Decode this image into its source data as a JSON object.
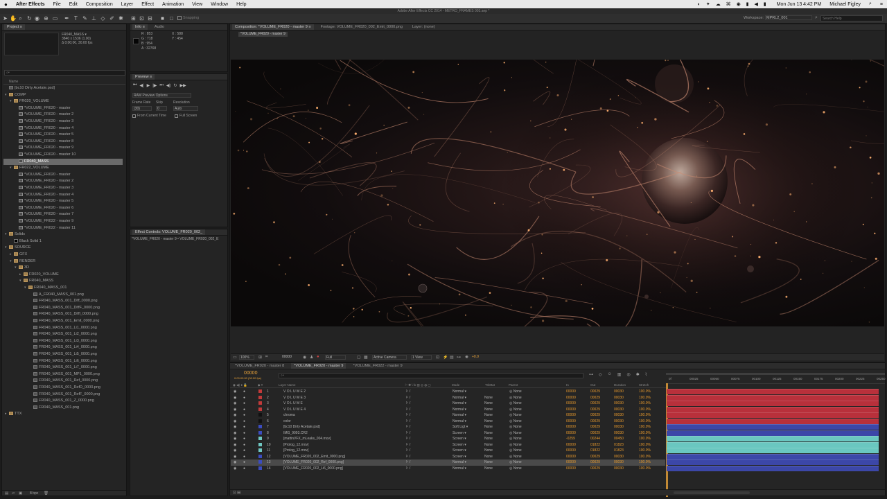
{
  "menubar": {
    "apple": "",
    "app": "After Effects",
    "items": [
      "File",
      "Edit",
      "Composition",
      "Layer",
      "Effect",
      "Animation",
      "View",
      "Window",
      "Help"
    ],
    "status_time": "Mon Jun 13 4:42 PM",
    "status_user": "Michael Figley"
  },
  "window_title": "Adobe After Effects CC 2014 - METRO_FRAMES 003.aep *",
  "toolbar": {
    "snapping_label": "Snapping",
    "workspace_label": "Workspace:",
    "workspace_value": "MPRL2_001",
    "search_placeholder": "Search Help"
  },
  "project": {
    "tab_label": "Project ≡",
    "selected_item": "FR040_MASS",
    "details": [
      "FR040_MASS ▾",
      "3840 x 1536 (1.00)",
      "Δ 0;00;00, 30.00 fps"
    ],
    "search_placeholder": "⌕▾",
    "col_name": "Name",
    "items": [
      {
        "indent": 0,
        "type": "file",
        "label": "[bc10 Dirty Acetate.psd]"
      },
      {
        "indent": 0,
        "type": "folder",
        "label": "COMP",
        "open": true
      },
      {
        "indent": 1,
        "type": "folder",
        "label": "FR020_VOLUME",
        "open": true
      },
      {
        "indent": 2,
        "type": "comp",
        "label": "*VOLUME_FR020 - master"
      },
      {
        "indent": 2,
        "type": "comp",
        "label": "*VOLUME_FR020 - master 2"
      },
      {
        "indent": 2,
        "type": "comp",
        "label": "*VOLUME_FR020 - master 3"
      },
      {
        "indent": 2,
        "type": "comp",
        "label": "*VOLUME_FR020 - master 4"
      },
      {
        "indent": 2,
        "type": "comp",
        "label": "*VOLUME_FR020 - master 5"
      },
      {
        "indent": 2,
        "type": "comp",
        "label": "*VOLUME_FR020 - master 8"
      },
      {
        "indent": 2,
        "type": "comp",
        "label": "*VOLUME_FR020 - master 9"
      },
      {
        "indent": 2,
        "type": "comp",
        "label": "*VOLUME_FR020 - master 10"
      },
      {
        "indent": 2,
        "type": "comp",
        "label": "FR040_MASS",
        "selected": true
      },
      {
        "indent": 1,
        "type": "folder",
        "label": "FR022_VOLUME",
        "open": true
      },
      {
        "indent": 2,
        "type": "comp",
        "label": "*VOLUME_FR020 - master"
      },
      {
        "indent": 2,
        "type": "comp",
        "label": "*VOLUME_FR020 - master 2"
      },
      {
        "indent": 2,
        "type": "comp",
        "label": "*VOLUME_FR020 - master 3"
      },
      {
        "indent": 2,
        "type": "comp",
        "label": "*VOLUME_FR020 - master 4"
      },
      {
        "indent": 2,
        "type": "comp",
        "label": "*VOLUME_FR020 - master 5"
      },
      {
        "indent": 2,
        "type": "comp",
        "label": "*VOLUME_FR020 - master 6"
      },
      {
        "indent": 2,
        "type": "comp",
        "label": "*VOLUME_FR020 - master 7"
      },
      {
        "indent": 2,
        "type": "comp",
        "label": "*VOLUME_FR022 - master 9"
      },
      {
        "indent": 2,
        "type": "comp",
        "label": "*VOLUME_FR022 - master 11"
      },
      {
        "indent": 0,
        "type": "folder",
        "label": "Solids",
        "open": true
      },
      {
        "indent": 1,
        "type": "solid",
        "label": "Black Solid 1"
      },
      {
        "indent": 0,
        "type": "folder",
        "label": "SOURCE",
        "open": true
      },
      {
        "indent": 1,
        "type": "folder",
        "label": "GFX"
      },
      {
        "indent": 1,
        "type": "folder",
        "label": "RENDER",
        "open": true
      },
      {
        "indent": 2,
        "type": "folder",
        "label": "3D",
        "open": true
      },
      {
        "indent": 3,
        "type": "folder",
        "label": "FR020_VOLUME"
      },
      {
        "indent": 3,
        "type": "folder",
        "label": "FR040_MASS",
        "open": true
      },
      {
        "indent": 4,
        "type": "folder",
        "label": "FR040_MASS_001",
        "open": true
      },
      {
        "indent": 5,
        "type": "file",
        "label": "A_FR040_MASS_001.png"
      },
      {
        "indent": 5,
        "type": "file",
        "label": "FR040_MASS_001_Diff_0000.png"
      },
      {
        "indent": 5,
        "type": "file",
        "label": "FR040_MASS_001_DiffF_0000.png"
      },
      {
        "indent": 5,
        "type": "file",
        "label": "FR040_MASS_001_Diffl_0000.png"
      },
      {
        "indent": 5,
        "type": "file",
        "label": "FR040_MASS_001_Emit_0000.png"
      },
      {
        "indent": 5,
        "type": "file",
        "label": "FR040_MASS_001_Li1_0000.png"
      },
      {
        "indent": 5,
        "type": "file",
        "label": "FR040_MASS_001_Li2_0000.png"
      },
      {
        "indent": 5,
        "type": "file",
        "label": "FR040_MASS_001_Li3_0000.png"
      },
      {
        "indent": 5,
        "type": "file",
        "label": "FR040_MASS_001_Li4_0000.png"
      },
      {
        "indent": 5,
        "type": "file",
        "label": "FR040_MASS_001_Li5_0000.png"
      },
      {
        "indent": 5,
        "type": "file",
        "label": "FR040_MASS_001_Li6_0000.png"
      },
      {
        "indent": 5,
        "type": "file",
        "label": "FR040_MASS_001_Li7_0000.png"
      },
      {
        "indent": 5,
        "type": "file",
        "label": "FR040_MASS_001_MP1_0000.png"
      },
      {
        "indent": 5,
        "type": "file",
        "label": "FR040_MASS_001_Ref_0000.png"
      },
      {
        "indent": 5,
        "type": "file",
        "label": "FR040_MASS_001_RefD_0000.png"
      },
      {
        "indent": 5,
        "type": "file",
        "label": "FR040_MASS_001_RefF_0000.png"
      },
      {
        "indent": 5,
        "type": "file",
        "label": "FR040_MASS_001_Z_0000.png"
      },
      {
        "indent": 5,
        "type": "file",
        "label": "FR040_MASS_001.png"
      },
      {
        "indent": 0,
        "type": "folder",
        "label": "TTX"
      }
    ],
    "footer_bpc": "8 bpc"
  },
  "info": {
    "tabs": [
      "Info ≡",
      "Audio"
    ],
    "r": "R : 853",
    "g": "G : 718",
    "b": "B : 954",
    "a": "A : 32768",
    "x": "X : 588",
    "y": "Y : 454"
  },
  "preview": {
    "tab": "Preview ≡",
    "ram_label": "RAM Preview Options",
    "frame_rate_label": "Frame Rate",
    "skip_label": "Skip",
    "resolution_label": "Resolution",
    "frame_rate_value": "(30)",
    "skip_value": "0",
    "resolution_value": "Auto",
    "from_current": "From Current Time",
    "full_screen": "Full Screen"
  },
  "effect_controls": {
    "tab": "Effect Controls: VOLUME_FR020_002_",
    "path": "*VOLUME_FR020 - master 9 • VOLUME_FR020_002_E"
  },
  "comp_viewer": {
    "tabs": [
      "Composition: *VOLUME_FR020 - master 9 ≡",
      "Footage: VOLUME_FR020_002_Emit_0000.png",
      "Layer: (none)"
    ],
    "flowchart_label": "*VOLUME_FR020 - master 9",
    "zoom": "100%",
    "timecode": "00000",
    "quality": "Full",
    "camera": "Active Camera",
    "view": "1 View",
    "exposure": "+0.0"
  },
  "timeline": {
    "tabs": [
      "*VOLUME_FR020 - master 8",
      "*VOLUME_FR020 - master 9",
      "*VOLUME_FR022 - master 9"
    ],
    "current_time": "00000",
    "current_time_sub": "0:00:00:00 (30.00 fps)",
    "columns": {
      "layer_name": "Layer Name",
      "mode": "Mode",
      "trkmat": "TrkMat",
      "parent": "Parent",
      "in": "In",
      "out": "Out",
      "duration": "Duration",
      "stretch": "Stretch"
    },
    "ruler": [
      "0f",
      "00025",
      "00050",
      "00075",
      "00100",
      "00125",
      "00150",
      "00175",
      "00200",
      "00225",
      "00250"
    ],
    "layers": [
      {
        "num": "1",
        "name": "V O L U M E  2",
        "label": "#c23a3a",
        "mode": "Normal",
        "trkmat": "",
        "parent": "None",
        "in": "00000",
        "out": "00029",
        "dur": "00030",
        "stretch": "100.0%",
        "bar": "red",
        "start": 0,
        "end": 1
      },
      {
        "num": "2",
        "name": "V O L U M E  3",
        "label": "#c23a3a",
        "mode": "Normal",
        "trkmat": "None",
        "parent": "None",
        "in": "00000",
        "out": "00029",
        "dur": "00030",
        "stretch": "100.0%",
        "bar": "red",
        "start": 0,
        "end": 1
      },
      {
        "num": "3",
        "name": "V O L U M E",
        "label": "#c23a3a",
        "mode": "Normal",
        "trkmat": "None",
        "parent": "None",
        "in": "00000",
        "out": "00029",
        "dur": "00030",
        "stretch": "100.0%",
        "bar": "red",
        "start": 0,
        "end": 1
      },
      {
        "num": "4",
        "name": "V O L U M E  4",
        "label": "#c23a3a",
        "mode": "Normal",
        "trkmat": "None",
        "parent": "None",
        "in": "00000",
        "out": "00029",
        "dur": "00030",
        "stretch": "100.0%",
        "bar": "red",
        "start": 0,
        "end": 1
      },
      {
        "num": "5",
        "name": "chroma",
        "label": "#111",
        "mode": "Normal",
        "trkmat": "None",
        "parent": "None",
        "in": "00000",
        "out": "00029",
        "dur": "00030",
        "stretch": "100.0%",
        "bar": "red",
        "start": 0,
        "end": 1
      },
      {
        "num": "6",
        "name": "color",
        "label": "#111",
        "mode": "Normal",
        "trkmat": "None",
        "parent": "None",
        "in": "00000",
        "out": "00029",
        "dur": "00030",
        "stretch": "100.0%",
        "bar": "red",
        "start": 0,
        "end": 1
      },
      {
        "num": "7",
        "name": "[bc10 Dirty Acetate.psd]",
        "label": "#3b4cc0",
        "mode": "Soft Ligt",
        "trkmat": "None",
        "parent": "None",
        "in": "00000",
        "out": "00029",
        "dur": "00030",
        "stretch": "100.0%",
        "bar": "blue",
        "start": 0,
        "end": 1
      },
      {
        "num": "8",
        "name": "IMG_9093.CR2",
        "label": "#3b4cc0",
        "mode": "Screen",
        "trkmat": "None",
        "parent": "None",
        "in": "00000",
        "out": "00029",
        "dur": "00030",
        "stretch": "100.0%",
        "bar": "blue",
        "start": 0,
        "end": 1
      },
      {
        "num": "9",
        "name": "[mattinVFX_mLeaks_004.mov]",
        "label": "#6fc7c2",
        "mode": "Screen",
        "trkmat": "None",
        "parent": "None",
        "in": "-0259",
        "out": "00244",
        "dur": "00450",
        "stretch": "100.0%",
        "bar": "teal",
        "start": 0,
        "end": 1
      },
      {
        "num": "10",
        "name": "[Prolog_12.mov]",
        "label": "#6fc7c2",
        "mode": "Screen",
        "trkmat": "None",
        "parent": "None",
        "in": "00000",
        "out": "01822",
        "dur": "01823",
        "stretch": "100.0%",
        "bar": "teal",
        "start": 0,
        "end": 1
      },
      {
        "num": "11",
        "name": "[Prolog_12.mov]",
        "label": "#6fc7c2",
        "mode": "Screen",
        "trkmat": "None",
        "parent": "None",
        "in": "00000",
        "out": "01822",
        "dur": "01823",
        "stretch": "100.0%",
        "bar": "teal",
        "start": 0,
        "end": 1
      },
      {
        "num": "12",
        "name": "[VOLUME_FR020_002_Emit_0000.png]",
        "label": "#3b4cc0",
        "mode": "Screen",
        "trkmat": "None",
        "parent": "None",
        "in": "00000",
        "out": "00029",
        "dur": "00030",
        "stretch": "100.0%",
        "bar": "blue",
        "start": 0,
        "end": 1
      },
      {
        "num": "13",
        "name": "[VOLUME_FR020_002_Ref_0000.png]",
        "label": "#3b4cc0",
        "mode": "Normal",
        "trkmat": "None",
        "parent": "None",
        "in": "00000",
        "out": "00029",
        "dur": "00030",
        "stretch": "100.0%",
        "bar": "blue",
        "selected": true,
        "start": 0,
        "end": 1
      },
      {
        "num": "14",
        "name": "[VOLUME_FR020_002_Li6_0000.png]",
        "label": "#3b4cc0",
        "mode": "Normal",
        "trkmat": "None",
        "parent": "None",
        "in": "00000",
        "out": "00029",
        "dur": "00030",
        "stretch": "100.0%",
        "bar": "blue",
        "start": 0,
        "end": 1
      }
    ],
    "bar_colors": {
      "red": "#b8303b",
      "blue": "#3c47a8",
      "teal": "#6ac7c0"
    },
    "toggle_label": "Toggle Switches / Modes"
  }
}
